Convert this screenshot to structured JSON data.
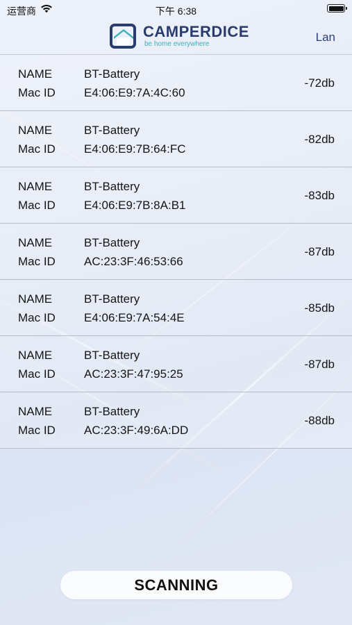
{
  "status_bar": {
    "carrier": "运营商",
    "time": "下午 6:38",
    "wifi_icon": "wifi-icon",
    "battery_icon": "battery-icon"
  },
  "header": {
    "brand": "CAMPERDICE",
    "tagline": "be home everywhere",
    "language_button": "Lan"
  },
  "devices": [
    {
      "name_label": "NAME",
      "mac_label": "Mac ID",
      "name": "BT-Battery",
      "mac": "E4:06:E9:7A:4C:60",
      "rssi": "-72db"
    },
    {
      "name_label": "NAME",
      "mac_label": "Mac ID",
      "name": "BT-Battery",
      "mac": "E4:06:E9:7B:64:FC",
      "rssi": "-82db"
    },
    {
      "name_label": "NAME",
      "mac_label": "Mac ID",
      "name": "BT-Battery",
      "mac": "E4:06:E9:7B:8A:B1",
      "rssi": "-83db"
    },
    {
      "name_label": "NAME",
      "mac_label": "Mac ID",
      "name": "BT-Battery",
      "mac": "AC:23:3F:46:53:66",
      "rssi": "-87db"
    },
    {
      "name_label": "NAME",
      "mac_label": "Mac ID",
      "name": "BT-Battery",
      "mac": "E4:06:E9:7A:54:4E",
      "rssi": "-85db"
    },
    {
      "name_label": "NAME",
      "mac_label": "Mac ID",
      "name": "BT-Battery",
      "mac": "AC:23:3F:47:95:25",
      "rssi": "-87db"
    },
    {
      "name_label": "NAME",
      "mac_label": "Mac ID",
      "name": "BT-Battery",
      "mac": "AC:23:3F:49:6A:DD",
      "rssi": "-88db"
    }
  ],
  "scan_button": {
    "label": "SCANNING"
  },
  "colors": {
    "brand_navy": "#2a3c6e",
    "brand_teal": "#3fb0b8",
    "row_divider": "#b6bcc7"
  }
}
